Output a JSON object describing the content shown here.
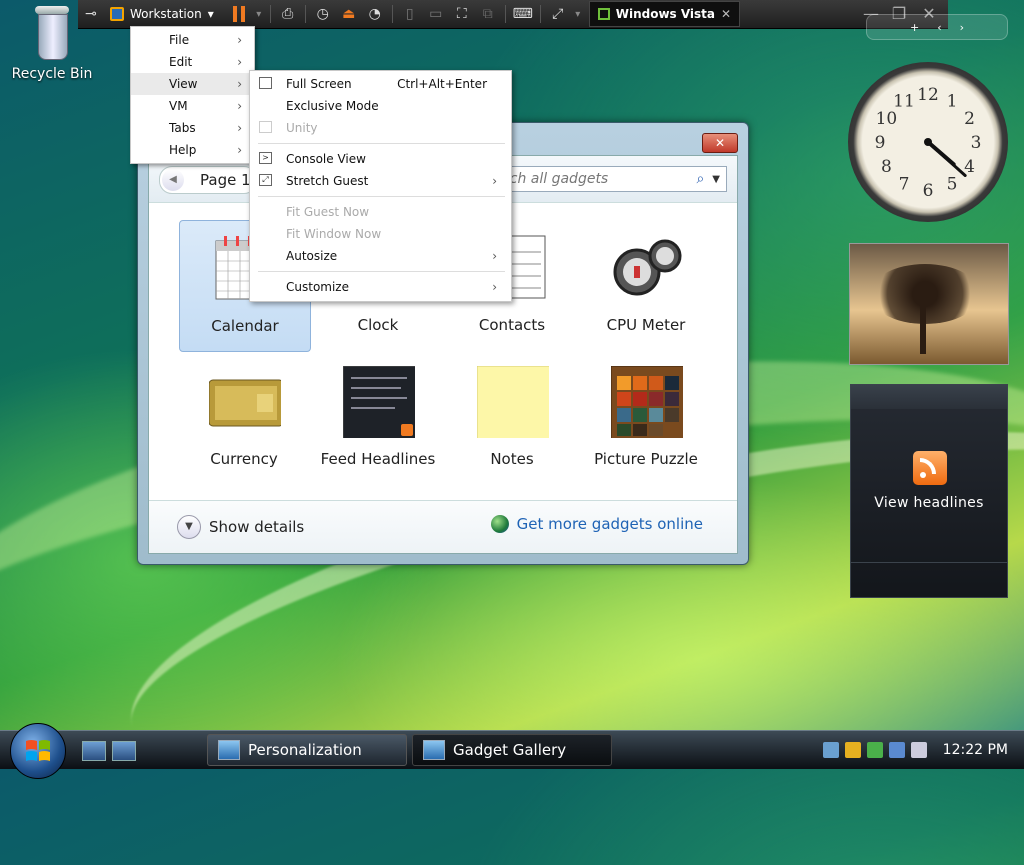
{
  "desktop": {
    "recycle_bin_label": "Recycle Bin"
  },
  "toolbar": {
    "product_label": "Workstation",
    "vm_tab_label": "Windows Vista",
    "tab_close": "✕"
  },
  "vm_menu": {
    "items": [
      {
        "label": "File"
      },
      {
        "label": "Edit"
      },
      {
        "label": "View"
      },
      {
        "label": "VM"
      },
      {
        "label": "Tabs"
      },
      {
        "label": "Help"
      }
    ]
  },
  "view_submenu": {
    "items": [
      {
        "label": "Full Screen",
        "shortcut": "Ctrl+Alt+Enter",
        "enabled": true
      },
      {
        "label": "Exclusive Mode",
        "enabled": true
      },
      {
        "label": "Unity",
        "enabled": false
      },
      {
        "label": "Console View",
        "enabled": true
      },
      {
        "label": "Stretch Guest",
        "enabled": true,
        "submenu": true
      },
      {
        "label": "Fit Guest Now",
        "enabled": false
      },
      {
        "label": "Fit Window Now",
        "enabled": false
      },
      {
        "label": "Autosize",
        "enabled": true,
        "submenu": true
      },
      {
        "label": "Customize",
        "enabled": true,
        "submenu": true
      }
    ]
  },
  "gallery": {
    "close_label": "✕",
    "page_label": "Page 1",
    "search_placeholder": "rch all gadgets",
    "gadgets": [
      {
        "label": "Calendar"
      },
      {
        "label": "Clock"
      },
      {
        "label": "Contacts"
      },
      {
        "label": "CPU Meter"
      },
      {
        "label": "Currency"
      },
      {
        "label": "Feed Headlines"
      },
      {
        "label": "Notes"
      },
      {
        "label": "Picture Puzzle"
      }
    ],
    "show_details_label": "Show details",
    "get_more_label": "Get more gadgets online"
  },
  "sidebar": {
    "feed_gadget_text": "View headlines"
  },
  "clock": {
    "hour": 4,
    "minute": 22,
    "numerals": [
      "12",
      "1",
      "2",
      "3",
      "4",
      "5",
      "6",
      "7",
      "8",
      "9",
      "10",
      "11"
    ]
  },
  "taskbar": {
    "tasks": [
      {
        "label": "Personalization",
        "active": false
      },
      {
        "label": "Gadget Gallery",
        "active": true
      }
    ],
    "time": "12:22 PM"
  }
}
